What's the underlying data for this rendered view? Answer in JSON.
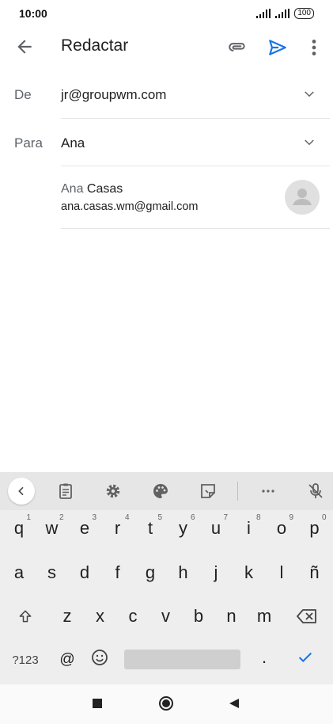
{
  "status_bar": {
    "time": "10:00",
    "battery": "100"
  },
  "app_bar": {
    "title": "Redactar",
    "icons": [
      "arrow-back-icon",
      "paperclip-icon",
      "send-icon",
      "more-vert-icon"
    ],
    "send_color": "#1a73e8"
  },
  "compose": {
    "from_label": "De",
    "from_value": "jr@groupwm.com",
    "to_label": "Para",
    "to_value": "Ana"
  },
  "suggestion": {
    "name_match": "Ana",
    "name_rest": " Casas",
    "email": "ana.casas.wm@gmail.com"
  },
  "keyboard": {
    "toolbar_icons": [
      "chevron-left-icon",
      "clipboard-icon",
      "settings-icon",
      "palette-icon",
      "sticker-icon",
      "more-horiz-icon",
      "mic-off-icon"
    ],
    "row1": [
      {
        "k": "q",
        "h": "1"
      },
      {
        "k": "w",
        "h": "2"
      },
      {
        "k": "e",
        "h": "3"
      },
      {
        "k": "r",
        "h": "4"
      },
      {
        "k": "t",
        "h": "5"
      },
      {
        "k": "y",
        "h": "6"
      },
      {
        "k": "u",
        "h": "7"
      },
      {
        "k": "i",
        "h": "8"
      },
      {
        "k": "o",
        "h": "9"
      },
      {
        "k": "p",
        "h": "0"
      }
    ],
    "row2": [
      "a",
      "s",
      "d",
      "f",
      "g",
      "h",
      "j",
      "k",
      "l",
      "ñ"
    ],
    "row3": [
      "z",
      "x",
      "c",
      "v",
      "b",
      "n",
      "m"
    ],
    "symbols_key": "?123",
    "at_key": "@",
    "period_key": ".",
    "shift_icon": "shift-icon",
    "backspace_icon": "backspace-icon",
    "emoji_icon": "emoji-icon",
    "enter_icon": "check-icon"
  },
  "nav_bar": {
    "icons": [
      "recents-square-icon",
      "home-circle-icon",
      "back-triangle-icon"
    ]
  }
}
